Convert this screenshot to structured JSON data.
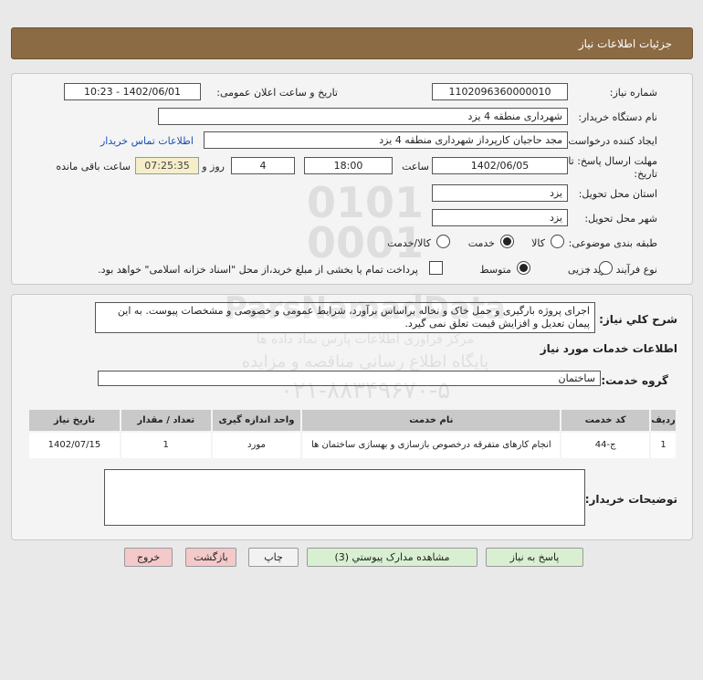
{
  "header": {
    "title": "جزئیات اطلاعات نیاز"
  },
  "form": {
    "need_number_label": "شماره نیاز:",
    "need_number": "1102096360000010",
    "announce_label": "تاریخ و ساعت اعلان عمومی:",
    "announce_value": "1402/06/01 - 10:23",
    "buyer_org_label": "نام دستگاه خریدار:",
    "buyer_org": "شهرداری منطقه 4 یزد",
    "creator_label": "ایجاد کننده درخواست:",
    "creator": "مجد حاجیان کارپرداز شهرداری منطقه 4 یزد",
    "contact_link": "اطلاعات تماس خریدار",
    "deadline_label_1": "مهلت ارسال پاسخ: تا",
    "deadline_label_2": "تاریخ:",
    "deadline_date": "1402/06/05",
    "time_label": "ساعت",
    "deadline_time": "18:00",
    "days_value": "4",
    "days_label": "روز و",
    "remaining_time": "07:25:35",
    "remaining_label": "ساعت باقی مانده",
    "province_label": "استان محل تحویل:",
    "province": "یزد",
    "city_label": "شهر محل تحویل:",
    "city": "یزد",
    "category_label": "طبقه بندی موضوعی:",
    "category_options": [
      "کالا",
      "خدمت",
      "کالا/خدمت"
    ],
    "process_label": "نوع فرآیند خرید :",
    "process_options": [
      "جزیی",
      "متوسط"
    ],
    "payment_note": "پرداخت تمام یا بخشی از مبلغ خرید،از محل \"اسناد خزانه اسلامی\" خواهد بود."
  },
  "description": {
    "label": "شرح کلي نياز:",
    "text": "اجرای پروژه بارگیری و حمل خاک و نخاله براساس برآورد، شرایط عمومی و خصوصی و مشخصات پیوست. به این پیمان تعدیل و افزایش قیمت تعلق نمی گیرد.",
    "services_title": "اطلاعات خدمات مورد نیاز",
    "service_group_label": "گروه خدمت:",
    "service_group": "ساختمان"
  },
  "table": {
    "headers": [
      "ردیف",
      "کد خدمت",
      "نام خدمت",
      "واحد اندازه گیری",
      "تعداد / مقدار",
      "تاریخ نیاز"
    ],
    "rows": [
      [
        "1",
        "ج-44",
        "انجام کارهای متفرقه درخصوص بازسازی و بهسازی ساختمان ها",
        "مورد",
        "1",
        "1402/07/15"
      ]
    ]
  },
  "buyer_notes": {
    "label": "توضیحات خریدار:",
    "text": ""
  },
  "buttons": {
    "reply": "پاسخ به نیاز",
    "attachments": "مشاهده مدارک پیوستي (3)",
    "print": "چاپ",
    "back": "بازگشت",
    "exit": "خروج"
  },
  "watermark": {
    "line1": "ParsNamadData",
    "line2": "مرکز فرآوری اطلاعات پارس نماد داده ها",
    "line3": "پایگاه اطلاع رسانی مناقصه و مزایده",
    "line4": "۰۲۱-۸۸۳۴۹۶۷۰-۵"
  },
  "colors": {
    "header": "#8b6b43",
    "panel": "#f4f4f4",
    "link": "#1a4fb5"
  }
}
